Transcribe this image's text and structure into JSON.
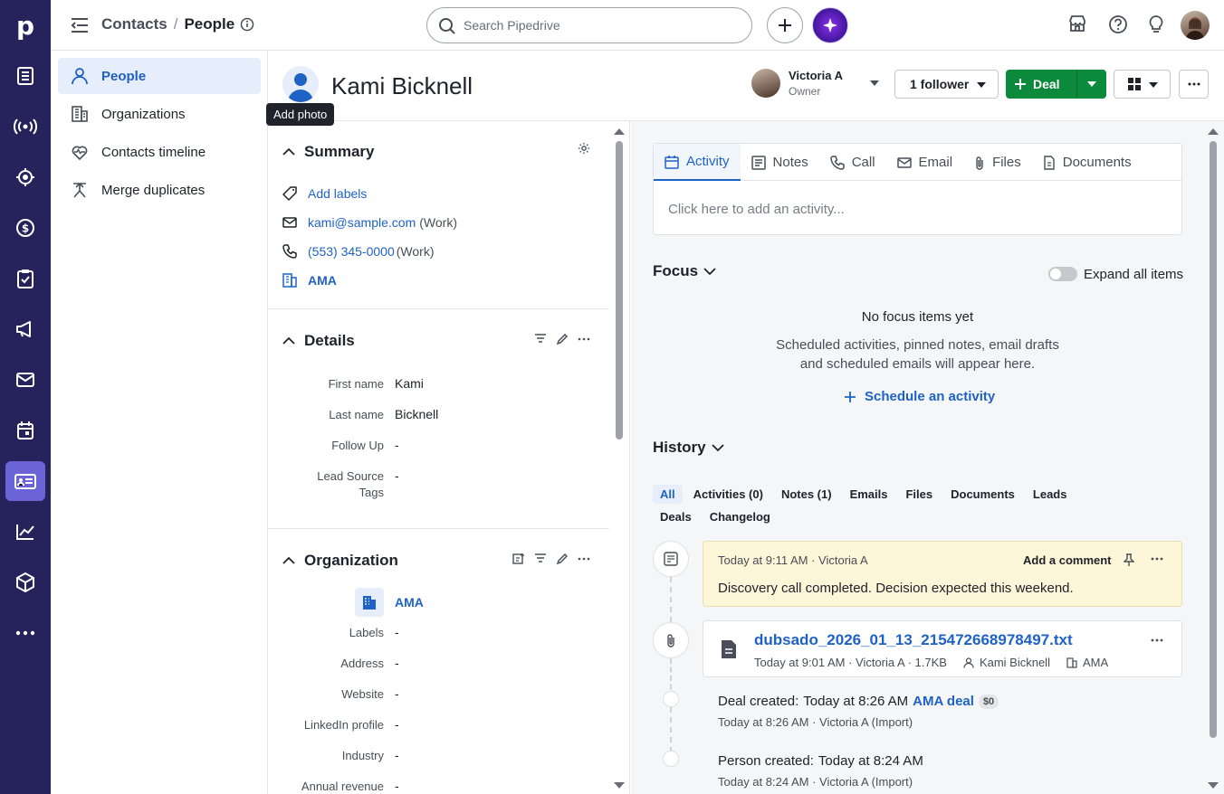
{
  "app": {
    "logo": "p"
  },
  "nav_rail": {
    "items": [
      {
        "icon": "leads-inbox-icon"
      },
      {
        "icon": "campaign-radar-icon"
      },
      {
        "icon": "target-icon"
      },
      {
        "icon": "deals-dollar-icon"
      },
      {
        "icon": "activities-clipboard-icon"
      },
      {
        "icon": "campaigns-megaphone-icon"
      },
      {
        "icon": "mail-icon"
      },
      {
        "icon": "calendar-icon"
      },
      {
        "icon": "contacts-card-icon",
        "active": true
      },
      {
        "icon": "insights-chart-icon"
      },
      {
        "icon": "products-box-icon"
      },
      {
        "icon": "more-dots-icon"
      }
    ]
  },
  "topbar": {
    "breadcrumb_parent": "Contacts",
    "breadcrumb_sep": "/",
    "breadcrumb_current": "People",
    "search_placeholder": "Search Pipedrive"
  },
  "sidebar": {
    "items": [
      {
        "label": "People",
        "active": true
      },
      {
        "label": "Organizations"
      },
      {
        "label": "Contacts timeline"
      },
      {
        "label": "Merge duplicates"
      }
    ]
  },
  "record": {
    "name": "Kami Bicknell",
    "tooltip": "Add photo",
    "owner_name": "Victoria A",
    "owner_role": "Owner",
    "follower_label": "1 follower",
    "deal_label": "Deal"
  },
  "summary": {
    "title": "Summary",
    "add_labels": "Add labels",
    "email": "kami@sample.com",
    "email_type": "(Work)",
    "phone": "(553) 345-0000",
    "phone_type": "(Work)",
    "organization": "AMA"
  },
  "details": {
    "title": "Details",
    "fields": [
      {
        "label": "First name",
        "value": "Kami"
      },
      {
        "label": "Last name",
        "value": "Bicknell"
      },
      {
        "label": "Follow Up",
        "value": "-"
      },
      {
        "label": "Lead Source Tags",
        "value": "-"
      }
    ]
  },
  "organization": {
    "title": "Organization",
    "name": "AMA",
    "fields": [
      {
        "label": "Labels",
        "value": "-"
      },
      {
        "label": "Address",
        "value": "-"
      },
      {
        "label": "Website",
        "value": "-"
      },
      {
        "label": "LinkedIn profile",
        "value": "-"
      },
      {
        "label": "Industry",
        "value": "-"
      },
      {
        "label": "Annual revenue",
        "value": "-"
      }
    ]
  },
  "composer": {
    "tabs": [
      {
        "label": "Activity",
        "icon": "calendar-icon",
        "active": true
      },
      {
        "label": "Notes",
        "icon": "note-icon"
      },
      {
        "label": "Call",
        "icon": "phone-icon"
      },
      {
        "label": "Email",
        "icon": "mail-icon"
      },
      {
        "label": "Files",
        "icon": "paperclip-icon"
      },
      {
        "label": "Documents",
        "icon": "document-icon"
      }
    ],
    "placeholder": "Click here to add an activity..."
  },
  "focus": {
    "title": "Focus",
    "expand_label": "Expand all items",
    "empty_title": "No focus items yet",
    "empty_line1": "Scheduled activities, pinned notes, email drafts",
    "empty_line2": "and scheduled emails will appear here.",
    "schedule_label": "Schedule an activity"
  },
  "history": {
    "title": "History",
    "filters": [
      "All",
      "Activities (0)",
      "Notes (1)",
      "Emails",
      "Files",
      "Documents",
      "Leads",
      "Deals",
      "Changelog"
    ],
    "note": {
      "meta": "Today at 9:11 AM · Victoria A",
      "add_comment": "Add a comment",
      "text": "Discovery call completed. Decision expected this weekend."
    },
    "file": {
      "name": "dubsado_2026_01_13_215472668978497.txt",
      "meta": "Today at 9:01 AM · Victoria A · 1.7KB",
      "person": "Kami Bicknell",
      "org": "AMA"
    },
    "deal_event": {
      "label": "Deal created",
      "colon": ":",
      "time": "Today at 8:26 AM",
      "deal": "AMA deal",
      "badge": "$0",
      "meta": "Today at 8:26 AM · Victoria A (Import)"
    },
    "person_event": {
      "label": "Person created",
      "colon": ":",
      "time": "Today at 8:24 AM",
      "meta": "Today at 8:24 AM · Victoria A (Import)"
    }
  },
  "colors": {
    "rail_bg": "#26235c",
    "rail_active": "#6b64d6",
    "link": "#1f62c6",
    "deal_green": "#0c8a3c",
    "note_bg": "#fdf6d8"
  }
}
